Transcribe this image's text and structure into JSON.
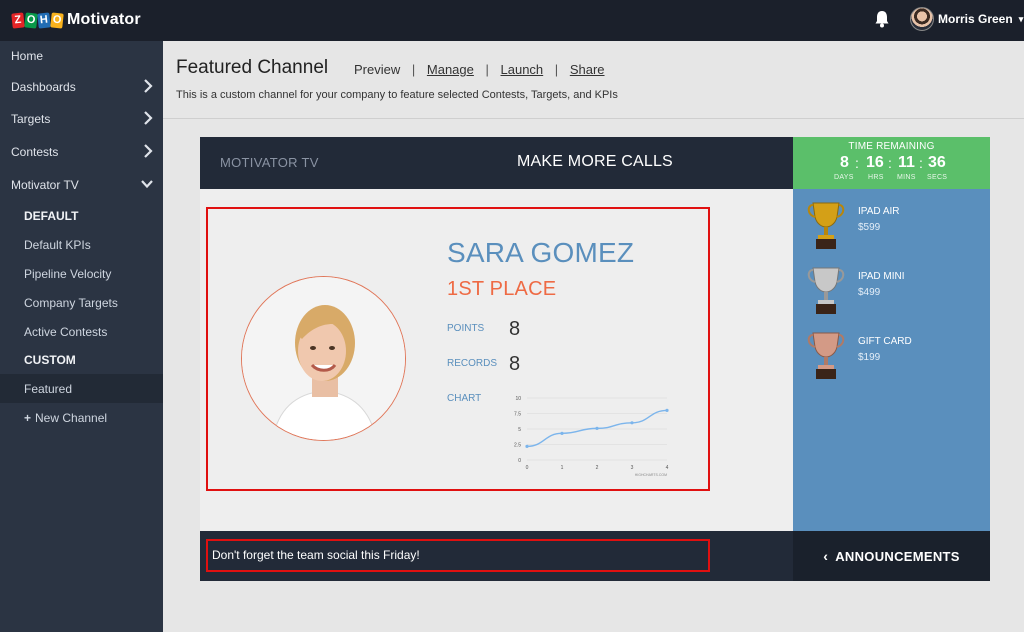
{
  "topbar": {
    "brand_logo_letters": [
      "Z",
      "O",
      "H",
      "O"
    ],
    "app_name": "Motivator",
    "user_name": "Morris Green",
    "user_caret": "▾"
  },
  "sidebar": {
    "items": [
      {
        "label": "Home"
      },
      {
        "label": "Dashboards"
      },
      {
        "label": "Targets"
      },
      {
        "label": "Contests"
      },
      {
        "label": "Motivator TV"
      }
    ],
    "tv_items": [
      {
        "label": "DEFAULT",
        "type": "header"
      },
      {
        "label": "Default KPIs",
        "type": "item"
      },
      {
        "label": "Pipeline Velocity",
        "type": "item"
      },
      {
        "label": "Company Targets",
        "type": "item"
      },
      {
        "label": "Active Contests",
        "type": "item"
      },
      {
        "label": "CUSTOM",
        "type": "header"
      },
      {
        "label": "Featured",
        "type": "active"
      }
    ],
    "new_channel_label": "New Channel",
    "new_channel_icon": "+"
  },
  "header": {
    "title": "Featured Channel",
    "preview": "Preview",
    "manage": "Manage",
    "launch": "Launch",
    "share": "Share",
    "separator": "|",
    "description": "This is a custom channel for your company to feature selected Contests, Targets, and KPIs"
  },
  "board": {
    "tv_label": "MOTIVATOR TV",
    "title": "MAKE MORE CALLS",
    "timer": {
      "title": "TIME REMAINING",
      "days": "8",
      "hrs": "16",
      "mins": "11",
      "secs": "36",
      "colon": ":",
      "days_label": "DAYS",
      "hrs_label": "HRS",
      "mins_label": "MINS",
      "secs_label": "SECS"
    },
    "prizes": [
      {
        "name": "IPAD AIR",
        "price": "$599",
        "color": "#d4a017"
      },
      {
        "name": "IPAD MINI",
        "price": "$499",
        "color": "#c0c0c0"
      },
      {
        "name": "GIFT CARD",
        "price": "$199",
        "color": "#c8856b"
      }
    ],
    "profile": {
      "name": "SARA GOMEZ",
      "place": "1ST PLACE",
      "points_label": "POINTS",
      "points": "8",
      "records_label": "RECORDS",
      "records": "8",
      "chart_label": "CHART"
    },
    "announcement": "Don't forget the team social this Friday!",
    "announcements_button": "ANNOUNCEMENTS",
    "announcements_icon": "‹"
  },
  "colors": {
    "accent_blue": "#5a8fbd",
    "accent_orange": "#ee6a44",
    "timer_green": "#5bbf6a",
    "dark_navy": "#222a38",
    "highlight_red": "#e01010"
  },
  "chart_data": {
    "type": "line",
    "x": [
      0,
      1,
      2,
      3,
      4
    ],
    "y_ticks": [
      "0",
      "2.5",
      "5",
      "7.5",
      "10"
    ],
    "x_ticks": [
      "0",
      "1",
      "2",
      "3",
      "4"
    ],
    "ylim": [
      0,
      10
    ],
    "xlim": [
      0,
      4
    ],
    "series": [
      {
        "values": [
          2.2,
          4.3,
          5.1,
          6.0,
          8.0
        ]
      }
    ],
    "credit": "HIGHCHARTS.COM",
    "grid": true,
    "line_color": "#7cb5ec"
  }
}
